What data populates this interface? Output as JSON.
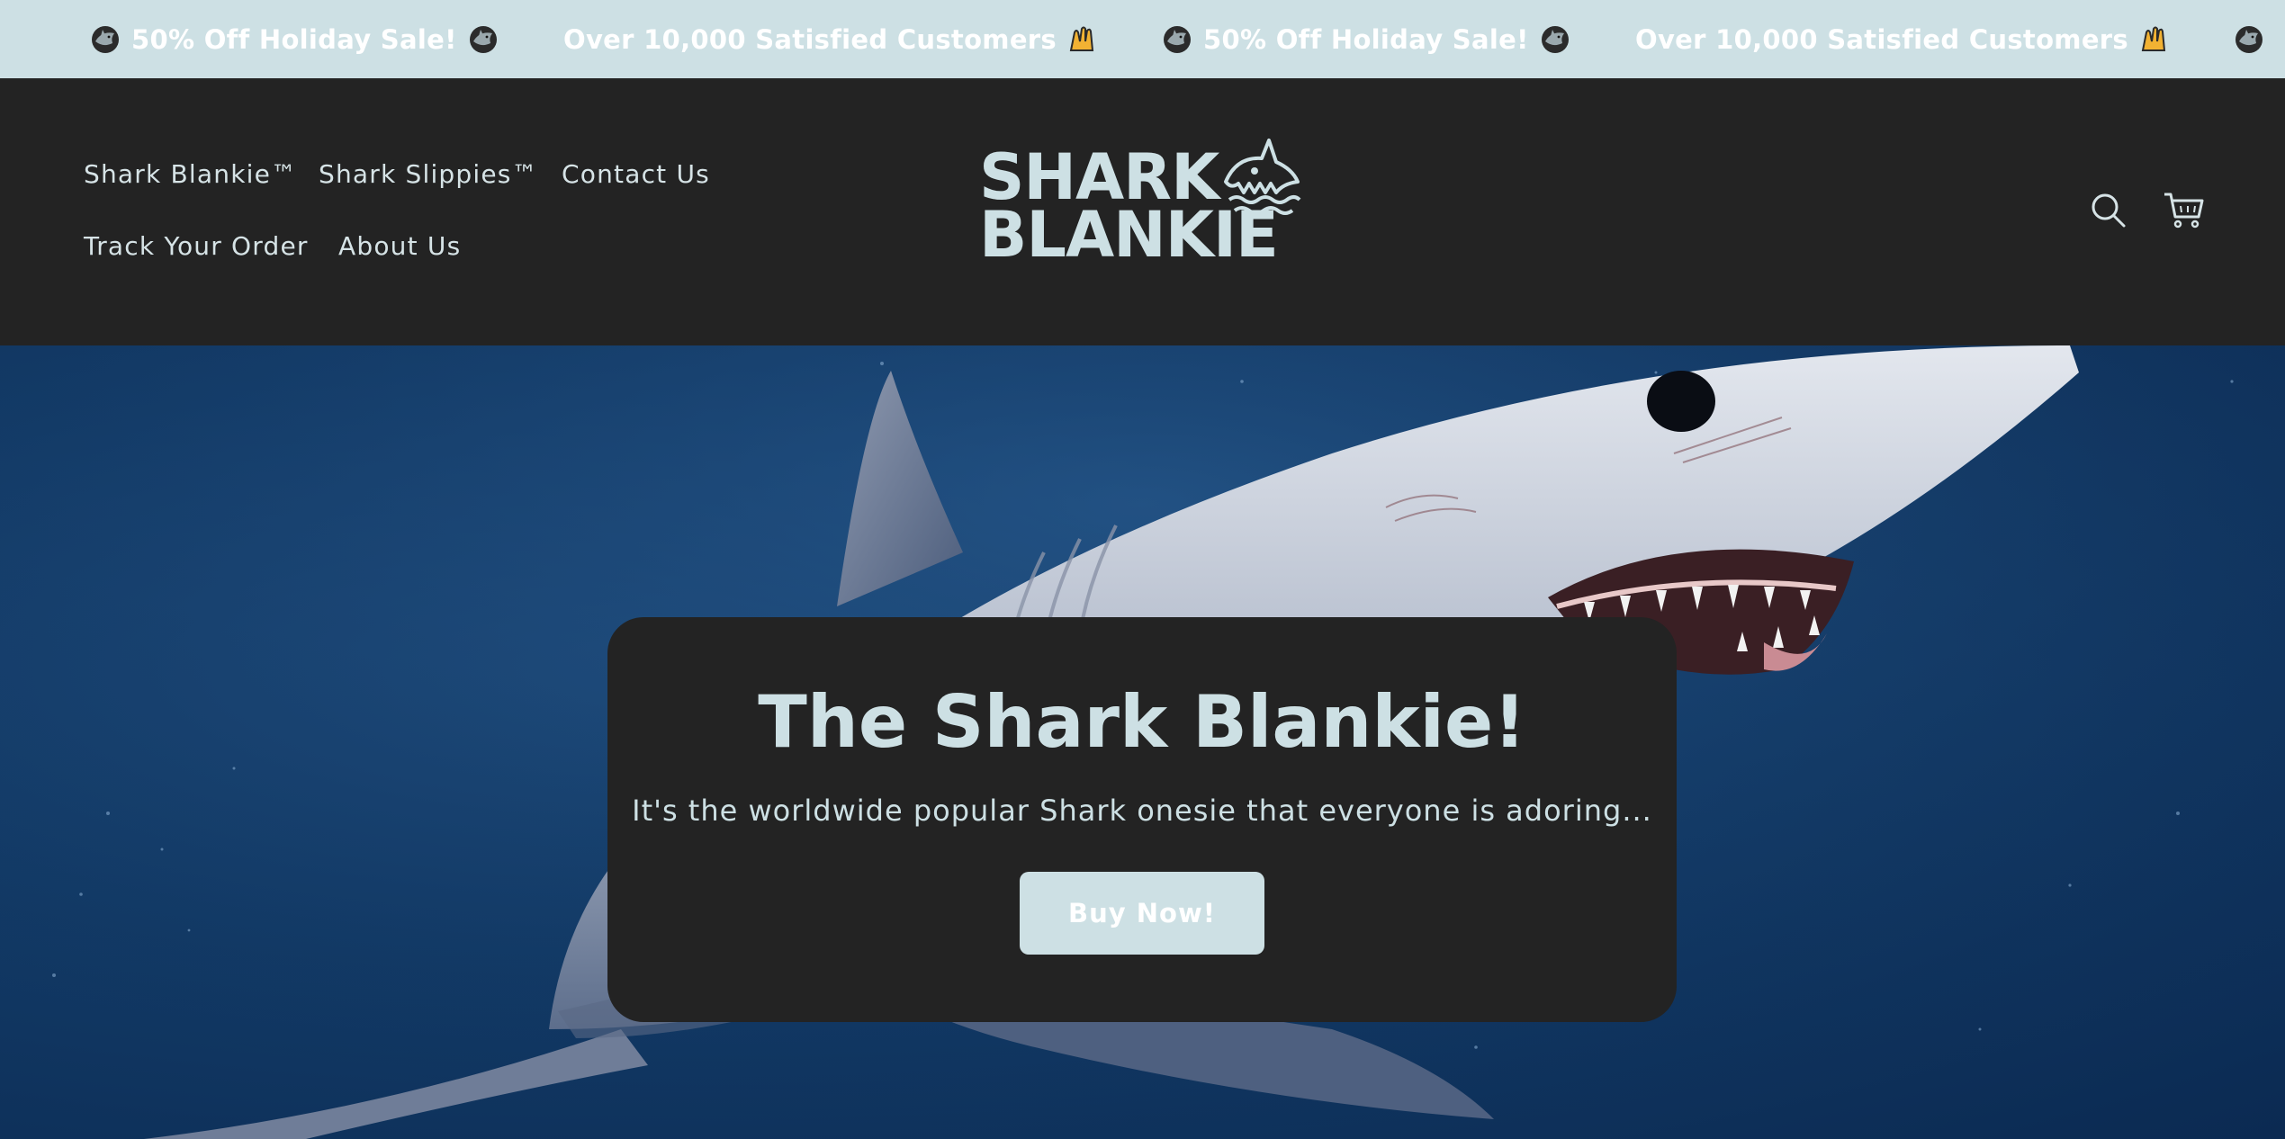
{
  "announcement": {
    "items": [
      {
        "text": "50% Off Holiday Sale!",
        "icon": "shark-emoji-icon"
      },
      {
        "text": "Over 10,000 Satisfied Customers",
        "icon": "raising-hands-emoji-icon"
      },
      {
        "text": "50% Off Holiday Sale!",
        "icon": "shark-emoji-icon"
      },
      {
        "text": "Over 10,000 Satisfied Customers",
        "icon": "raising-hands-emoji-icon"
      }
    ]
  },
  "header": {
    "nav": [
      {
        "label": "Shark Blankie™"
      },
      {
        "label": "Shark Slippies™"
      },
      {
        "label": "Contact Us"
      },
      {
        "label": "Track Your Order"
      },
      {
        "label": "About Us"
      }
    ],
    "logo": {
      "line1": "SHARK",
      "line2": "BLANKIE"
    },
    "icons": [
      "search-icon",
      "cart-icon"
    ]
  },
  "hero": {
    "title": "The Shark Blankie!",
    "subtitle": "It's the worldwide popular Shark onesie that everyone is adoring...",
    "cta_label": "Buy Now!"
  },
  "colors": {
    "accent": "#cde0e4",
    "header_bg": "#232323",
    "ocean": "#123a66"
  }
}
